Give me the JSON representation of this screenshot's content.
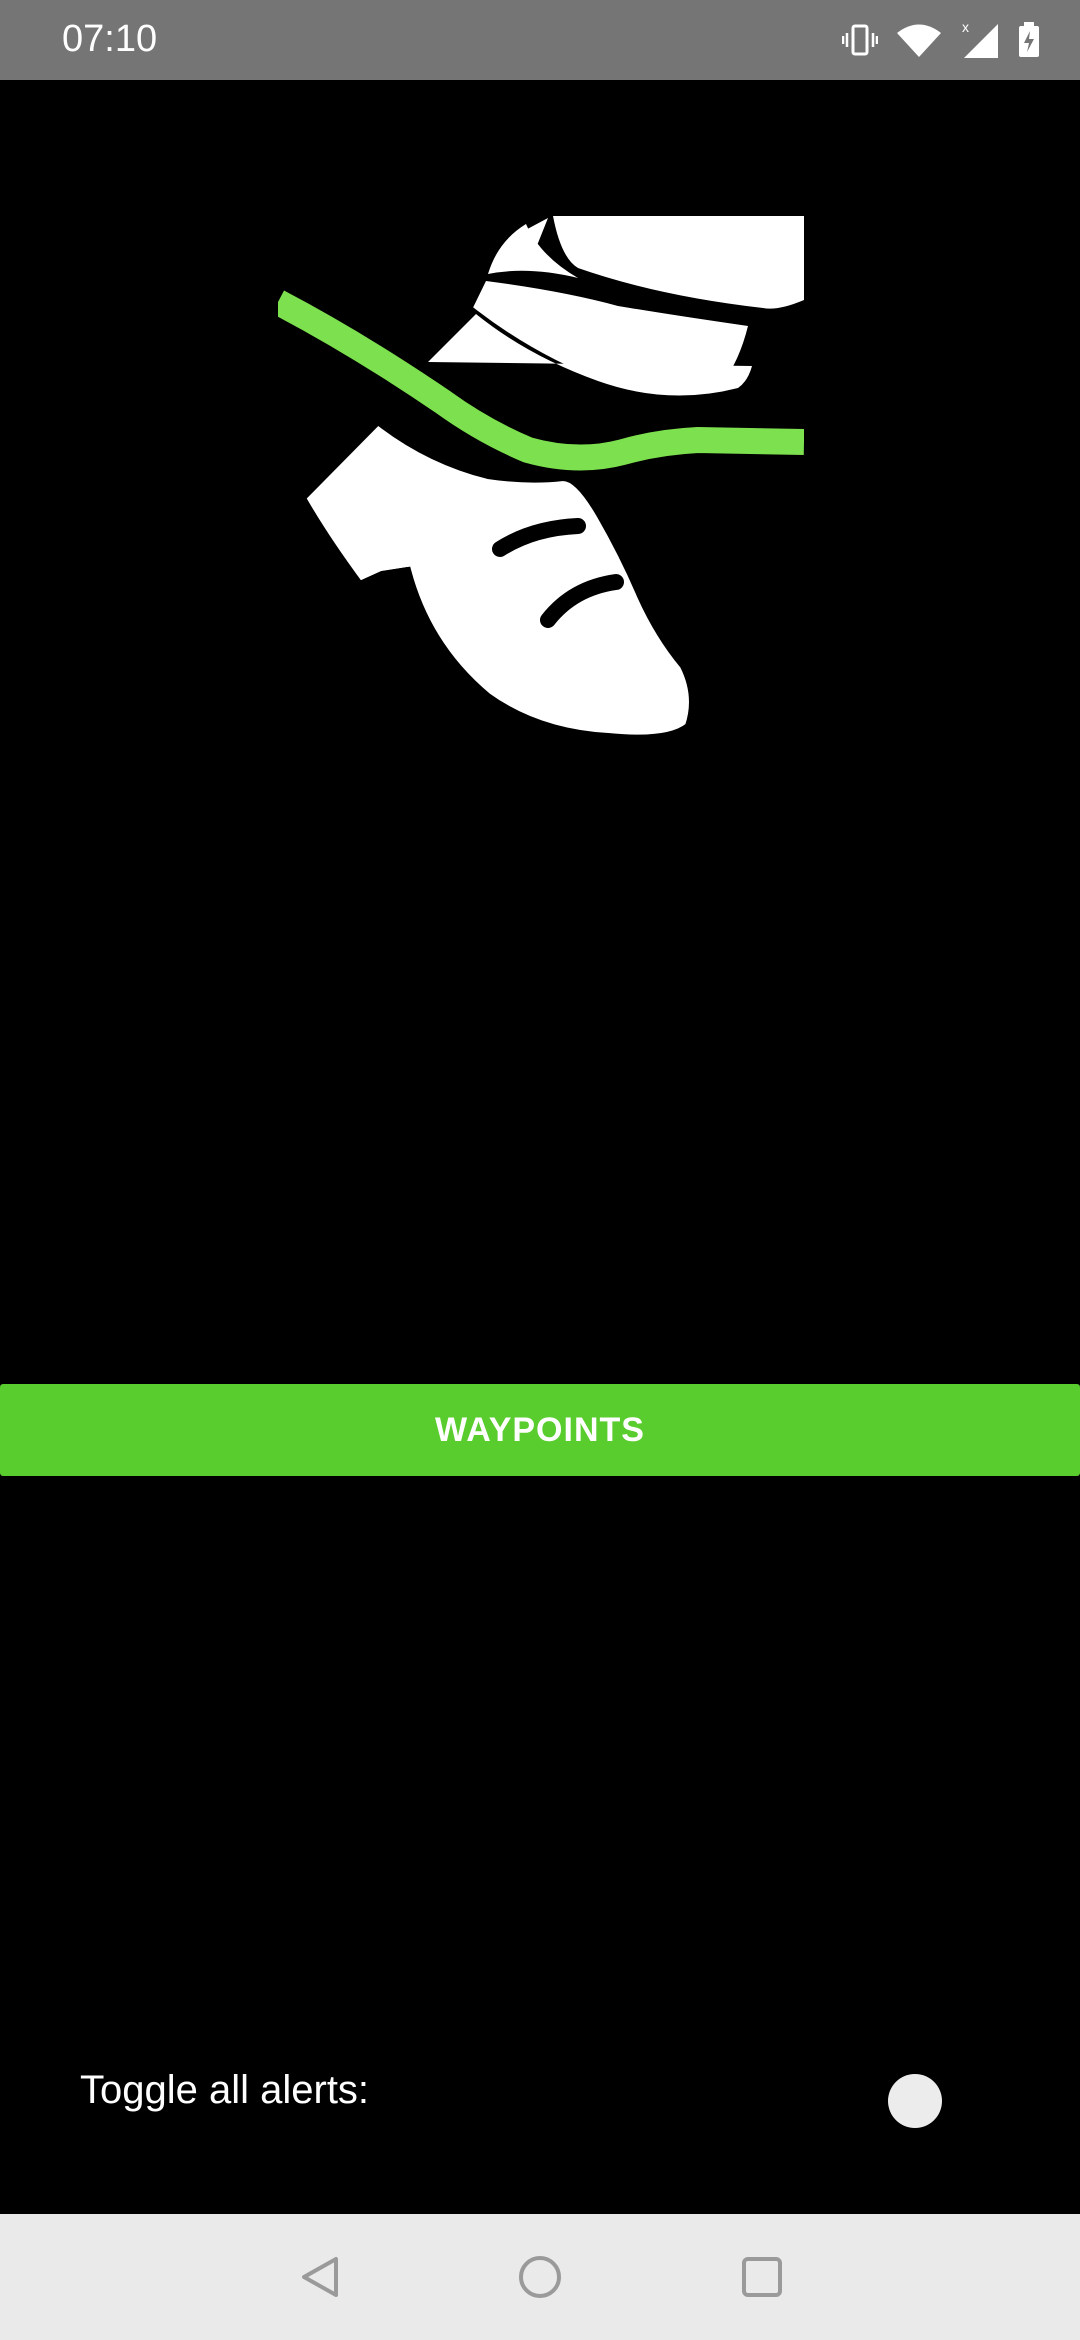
{
  "status_bar": {
    "time": "07:10",
    "icons": [
      "vibrate-icon",
      "wifi-icon",
      "cell-signal-icon",
      "battery-charging-icon"
    ]
  },
  "logo": {
    "icon": "walking-shoe-logo-icon",
    "colors": {
      "shoe": "#ffffff",
      "outline": "#000000",
      "path": "#7de04e"
    }
  },
  "main": {
    "waypoints_label": "WAYPOINTS",
    "button_color": "#59cc2e"
  },
  "alerts": {
    "toggle_label": "Toggle all alerts:",
    "toggle_state": "off"
  },
  "nav_bar": {
    "buttons": [
      "back-icon",
      "home-icon",
      "recents-icon"
    ]
  }
}
